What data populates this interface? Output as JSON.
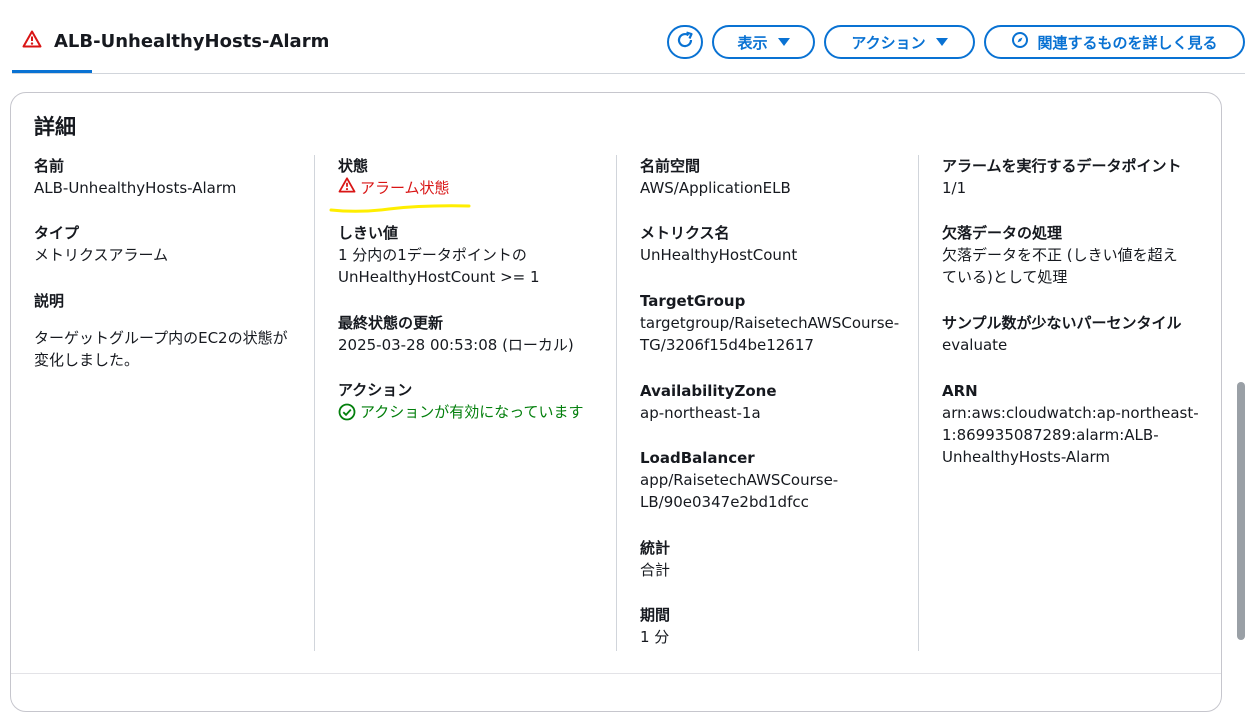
{
  "header": {
    "alarm_name": "ALB-UnhealthyHosts-Alarm",
    "view_label": "表示",
    "actions_label": "アクション",
    "related_label": "関連するものを詳しく見る"
  },
  "details": {
    "title": "詳細",
    "col1": {
      "name_label": "名前",
      "name_value": "ALB-UnhealthyHosts-Alarm",
      "type_label": "タイプ",
      "type_value": "メトリクスアラーム",
      "desc_label": "説明",
      "desc_value": "ターゲットグループ内のEC2の状態が変化しました。"
    },
    "col2": {
      "state_label": "状態",
      "state_value": "アラーム状態",
      "threshold_label": "しきい値",
      "threshold_value_1": "1 分内の1データポイントの",
      "threshold_value_2": "UnHealthyHostCount >= 1",
      "last_update_label": "最終状態の更新",
      "last_update_value": "2025-03-28 00:53:08 (ローカル)",
      "action_label": "アクション",
      "action_value": "アクションが有効になっています"
    },
    "col3": {
      "namespace_label": "名前空間",
      "namespace_value": "AWS/ApplicationELB",
      "metric_label": "メトリクス名",
      "metric_value": "UnHealthyHostCount",
      "tg_label": "TargetGroup",
      "tg_value_1": "targetgroup/RaisetechAWSCourse-",
      "tg_value_2": "TG/3206f15d4be12617",
      "az_label": "AvailabilityZone",
      "az_value": "ap-northeast-1a",
      "lb_label": "LoadBalancer",
      "lb_value_1": "app/RaisetechAWSCourse-",
      "lb_value_2": "LB/90e0347e2bd1dfcc",
      "stat_label": "統計",
      "stat_value": "合計",
      "period_label": "期間",
      "period_value": "1 分"
    },
    "col4": {
      "datapoints_label": "アラームを実行するデータポイント",
      "datapoints_value": "1/1",
      "missing_label": "欠落データの処理",
      "missing_value_1": "欠落データを不正 (しきい値を超え",
      "missing_value_2": "ている)として処理",
      "percentile_label": "サンプル数が少ないパーセンタイル",
      "percentile_value": "evaluate",
      "arn_label": "ARN",
      "arn_value_1": "arn:aws:cloudwatch:ap-northeast-",
      "arn_value_2": "1:869935087289:alarm:ALB-",
      "arn_value_3": "UnhealthyHosts-Alarm"
    }
  },
  "colors": {
    "accent": "#0972d3",
    "alarm": "#d91515",
    "ok": "#037f0c",
    "highlight": "#ffee00"
  }
}
